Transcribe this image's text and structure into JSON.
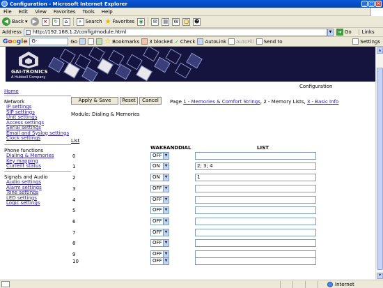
{
  "window": {
    "title": "Configuration - Microsoft Internet Explorer"
  },
  "menu": [
    "File",
    "Edit",
    "View",
    "Favorites",
    "Tools",
    "Help"
  ],
  "toolbar": {
    "back": "Back",
    "search": "Search",
    "favorites": "Favorites"
  },
  "address": {
    "label": "Address",
    "url": "http://192.168.1.2/config/module.html",
    "go": "Go",
    "links": "Links"
  },
  "google": {
    "field": "G-",
    "go": "Go",
    "bookmarks": "Bookmarks",
    "blocked": "3 blocked",
    "check": "Check",
    "autolink": "AutoLink",
    "autofill": "AutoFill",
    "sendto": "Send to",
    "settings": "Settings"
  },
  "banner": {
    "brand": "GAI-TRONICS",
    "sub": "A Hubbell Company"
  },
  "page": {
    "config_title": "Configuration"
  },
  "nav": {
    "home": "Home",
    "groups": [
      {
        "title": "Network",
        "items": [
          "IP settings",
          "SIP settings",
          "Unit settings",
          "Access settings",
          "Serial settings",
          "Email and Syslog settings",
          "Clock settings"
        ]
      },
      {
        "title": "Phone functions",
        "items": [
          "Dialing & Memories",
          "Key mapping",
          "Current status"
        ]
      },
      {
        "title": "Signals and Audio",
        "items": [
          "Audio settings",
          "Alarm settings",
          "Tone settings",
          "LED settings",
          "Logic settings"
        ]
      }
    ]
  },
  "actions": {
    "apply": "Apply & Save",
    "reset": "Reset",
    "cancel": "Cancel"
  },
  "pagination": {
    "prefix": "Page",
    "link1": "1 - Memories & Comfort Strings",
    "sep1": ",",
    "current": "2 - Memory Lists",
    "sep2": ",",
    "link3": "3 - Basic Info"
  },
  "module": {
    "title": "Module: Dialing & Memories"
  },
  "list": {
    "link": "List",
    "header_wake": "WAKEANDDIAL",
    "header_list": "LIST",
    "rows": [
      {
        "num": "0",
        "wake": "OFF",
        "list": ""
      },
      {
        "num": "1",
        "wake": "ON",
        "list": "2; 3; 4"
      },
      {
        "num": "2",
        "wake": "ON",
        "list": "1"
      },
      {
        "num": "3",
        "wake": "OFF",
        "list": ""
      },
      {
        "num": "4",
        "wake": "OFF",
        "list": ""
      },
      {
        "num": "5",
        "wake": "OFF",
        "list": ""
      },
      {
        "num": "6",
        "wake": "OFF",
        "list": ""
      },
      {
        "num": "7",
        "wake": "OFF",
        "list": ""
      },
      {
        "num": "8",
        "wake": "OFF",
        "list": ""
      },
      {
        "num": "9",
        "wake": "OFF",
        "list": ""
      },
      {
        "num": "10",
        "wake": "OFF",
        "list": ""
      }
    ]
  },
  "status": {
    "zone": "Internet"
  },
  "icons": [
    "ie-icon",
    "back-icon",
    "forward-icon",
    "stop-icon",
    "refresh-icon",
    "home-icon",
    "search-icon",
    "favorites-icon",
    "media-icon",
    "mail-icon",
    "print-icon",
    "edit-icon",
    "discuss-icon",
    "messenger-icon",
    "page-icon",
    "go-icon",
    "star-icon",
    "globe-icon"
  ]
}
